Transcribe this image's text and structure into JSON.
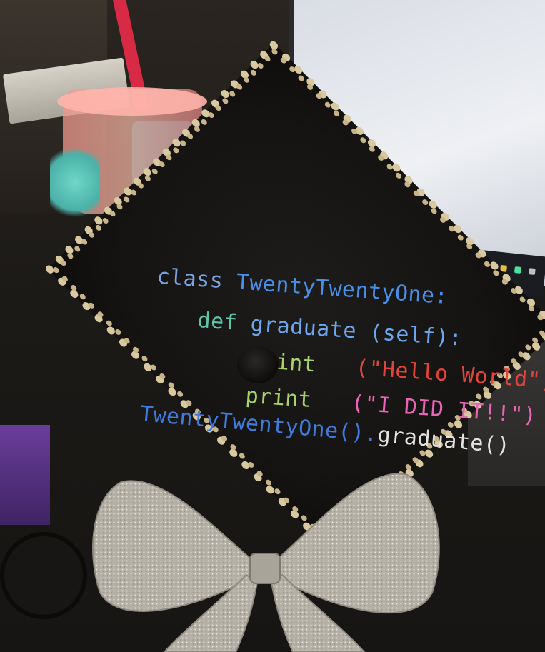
{
  "code_lines": {
    "line1_kw": "class",
    "line1_name": "TwentyTwentyOne:",
    "line2_kw": "def",
    "line2_name": "graduate (self):",
    "line3_kw": "print",
    "line3_arg": "(\"Hello World\")",
    "line4_kw": "print",
    "line4_arg": "(\"I DID IT!!\")",
    "line5_obj": "TwentyTwentyOne().",
    "line5_call": "graduate()"
  },
  "colors": {
    "class_kw": "#7aa6e6",
    "class_name": "#4a8fe6",
    "def_kw": "#5cc6a8",
    "def_name": "#6aa7ef",
    "print_kw": "#a9d36a",
    "hello_arg": "#e0443c",
    "did_arg": "#e865b8",
    "obj": "#3f7bdc",
    "call": "#e2e2e2",
    "rhinestone": "#d9c9a0",
    "bow": "#b9b6ad"
  },
  "icons": {
    "cap_button": "cap-button-icon",
    "bow": "glitter-bow-icon"
  }
}
